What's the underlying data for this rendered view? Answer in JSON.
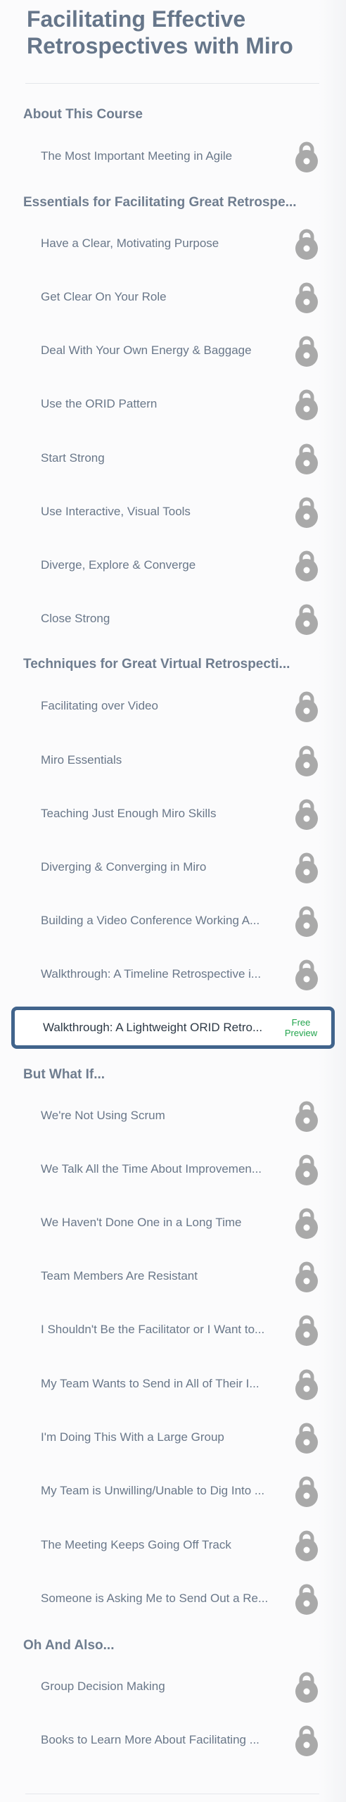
{
  "course": {
    "title": "Facilitating Effective Retrospectives with Miro"
  },
  "icons": {
    "lock": "lock-icon"
  },
  "colors": {
    "title": "#66768a",
    "section": "#6f7d8f",
    "lecture": "#697789",
    "lock": "#a9a9a9",
    "active_border": "#41648c",
    "free_preview": "#22a44d"
  },
  "sections": [
    {
      "title": "About This Course",
      "lectures": [
        {
          "label": "The Most Important Meeting in Agile",
          "locked": true
        }
      ]
    },
    {
      "title": "Essentials for Facilitating Great Retrospe...",
      "lectures": [
        {
          "label": "Have a Clear, Motivating Purpose",
          "locked": true
        },
        {
          "label": "Get Clear On Your Role",
          "locked": true
        },
        {
          "label": "Deal With Your Own Energy & Baggage",
          "locked": true
        },
        {
          "label": "Use the ORID Pattern",
          "locked": true
        },
        {
          "label": "Start Strong",
          "locked": true
        },
        {
          "label": "Use Interactive, Visual Tools",
          "locked": true
        },
        {
          "label": "Diverge, Explore & Converge",
          "locked": true
        },
        {
          "label": "Close Strong",
          "locked": true
        }
      ]
    },
    {
      "title": "Techniques for Great Virtual Retrospecti...",
      "lectures": [
        {
          "label": "Facilitating over Video",
          "locked": true
        },
        {
          "label": "Miro Essentials",
          "locked": true
        },
        {
          "label": "Teaching Just Enough Miro Skills",
          "locked": true
        },
        {
          "label": "Diverging & Converging in Miro",
          "locked": true
        },
        {
          "label": "Building a Video Conference Working A...",
          "locked": true
        },
        {
          "label": "Walkthrough: A Timeline Retrospective i...",
          "locked": true
        },
        {
          "label": "Walkthrough: A Lightweight ORID Retro...",
          "locked": false,
          "active": true,
          "badge": "Free Preview"
        }
      ]
    },
    {
      "title": "But What If...",
      "lectures": [
        {
          "label": "We're Not Using Scrum",
          "locked": true
        },
        {
          "label": "We Talk All the Time About Improvemen...",
          "locked": true
        },
        {
          "label": "We Haven't Done One in a Long Time",
          "locked": true
        },
        {
          "label": "Team Members Are Resistant",
          "locked": true
        },
        {
          "label": "I Shouldn't Be the Facilitator or I Want to...",
          "locked": true
        },
        {
          "label": "My Team Wants to Send in All of Their I...",
          "locked": true
        },
        {
          "label": "I'm Doing This With a Large Group",
          "locked": true
        },
        {
          "label": "My Team is Unwilling/Unable to Dig Into ...",
          "locked": true
        },
        {
          "label": "The Meeting Keeps Going Off Track",
          "locked": true
        },
        {
          "label": "Someone is Asking Me to Send Out a Re...",
          "locked": true
        }
      ]
    },
    {
      "title": "Oh And Also...",
      "lectures": [
        {
          "label": "Group Decision Making",
          "locked": true
        },
        {
          "label": "Books to Learn More About Facilitating ...",
          "locked": true
        }
      ]
    }
  ]
}
